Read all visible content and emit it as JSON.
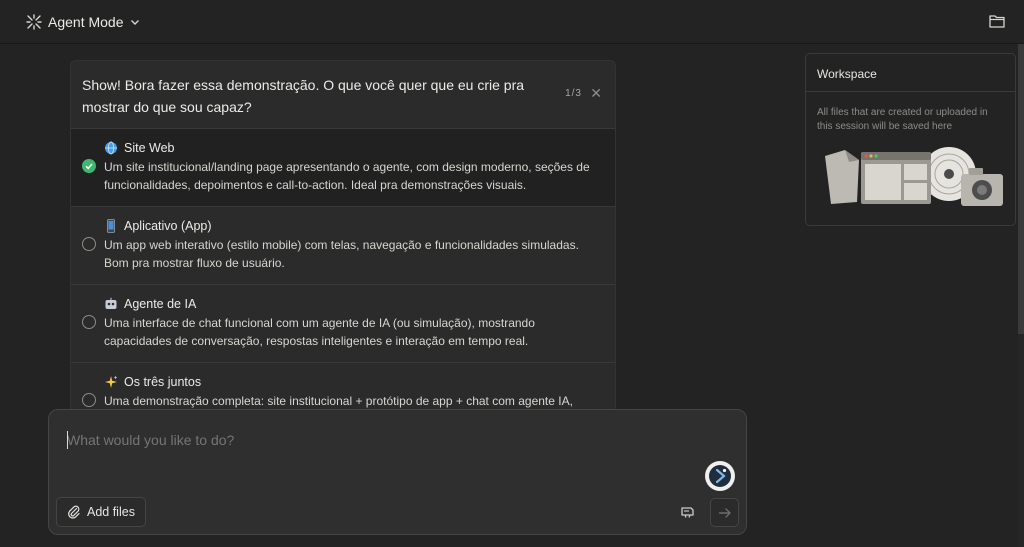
{
  "header": {
    "mode_label": "Agent Mode",
    "mode_icon": "agent-burst-icon",
    "chevron_icon": "chevron-down-icon",
    "folder_icon": "folder-icon"
  },
  "question": {
    "title": "Show! Bora fazer essa demonstração. O que você quer que eu crie pra mostrar do que sou capaz?",
    "counter": "1/3",
    "close_icon": "close-icon",
    "options": [
      {
        "icon": "globe-emoji",
        "title": "Site Web",
        "description": "Um site institucional/landing page apresentando o agente, com design moderno, seções de funcionalidades, depoimentos e call-to-action. Ideal pra demonstrações visuais.",
        "selected": true
      },
      {
        "icon": "phone-emoji",
        "title": "Aplicativo (App)",
        "description": "Um app web interativo (estilo mobile) com telas, navegação e funcionalidades simuladas. Bom pra mostrar fluxo de usuário.",
        "selected": false
      },
      {
        "icon": "robot-emoji",
        "title": "Agente de IA",
        "description": "Uma interface de chat funcional com um agente de IA (ou simulação), mostrando capacidades de conversação, respostas inteligentes e interação em tempo real.",
        "selected": false
      },
      {
        "icon": "sparkles-emoji",
        "title": "Os três juntos",
        "description": "Uma demonstração completa: site institucional + protótipo de app + chat com agente IA,",
        "selected": false
      }
    ]
  },
  "workspace": {
    "title": "Workspace",
    "description": "All files that are created or uploaded in this session will be saved here",
    "illustration_icon": "files-illustration-icon"
  },
  "composer": {
    "placeholder": "What would you like to do?",
    "add_files_label": "Add files",
    "paperclip_icon": "paperclip-icon",
    "assistant_icon": "assistant-logo-icon",
    "tool_icon": "tool-icon",
    "send_icon": "arrow-right-icon"
  },
  "colors": {
    "background": "#232323",
    "panel": "#2b2b2b",
    "selected_check": "#3fb86f"
  }
}
